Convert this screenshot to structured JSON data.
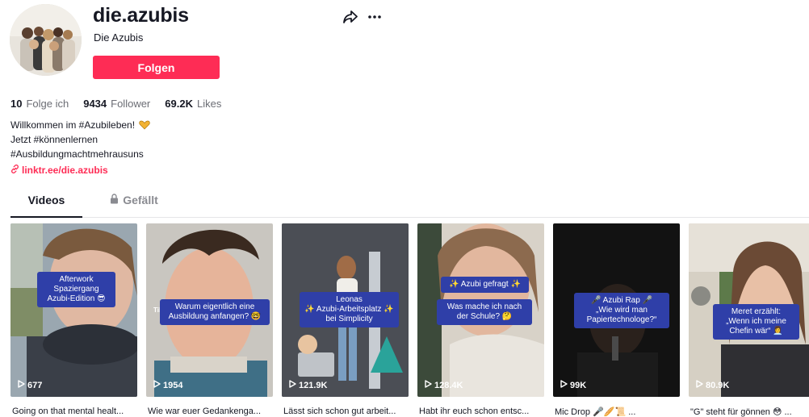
{
  "profile": {
    "username": "die.azubis",
    "nickname": "Die Azubis",
    "follow_label": "Folgen",
    "stats": [
      {
        "value": "10",
        "label": "Folge ich"
      },
      {
        "value": "9434",
        "label": "Follower"
      },
      {
        "value": "69.2K",
        "label": "Likes"
      }
    ],
    "bio": {
      "line1": "Willkommen im #Azubileben!",
      "line2": "Jetzt #könnenlernen",
      "line3": "#Ausbildungmachtmehrausuns"
    },
    "link": "linktr.ee/die.azubis"
  },
  "tabs": {
    "videos": "Videos",
    "liked": "Gefällt"
  },
  "colors": {
    "brand": "#fe2c55",
    "caption_bg": "#2f3fa8"
  },
  "videos": [
    {
      "views": "677",
      "description": "Going on that mental healt...",
      "caption": "Afterwork\nSpaziergang\nAzubi-Edition 😎"
    },
    {
      "views": "1954",
      "description": "Wie war euer Gedankenga...",
      "caption": "Warum eigentlich eine\nAusbildung anfangen? 🤓",
      "watermark": "TikTok"
    },
    {
      "views": "121.9K",
      "description": "Lässt sich schon gut arbeit...",
      "caption": "Leonas\n✨ Azubi-Arbeitsplatz ✨\nbei Simplicity"
    },
    {
      "views": "128.4K",
      "description": "Habt ihr euch schon entsc...",
      "caption_top": "✨ Azubi gefragt ✨",
      "caption": "Was mache ich nach\nder Schule? 🤔"
    },
    {
      "views": "99K",
      "description": "Mic Drop 🎤🥖📜 ...",
      "caption": "🎤 Azubi Rap 🎤\n„Wie wird man\nPapiertechnologe?“"
    },
    {
      "views": "80.9K",
      "description": "\"G\" steht für gönnen 😳 ...",
      "caption": "Meret erzählt:\n„Wenn ich meine\nChefin wär“ 👩‍💼"
    }
  ]
}
